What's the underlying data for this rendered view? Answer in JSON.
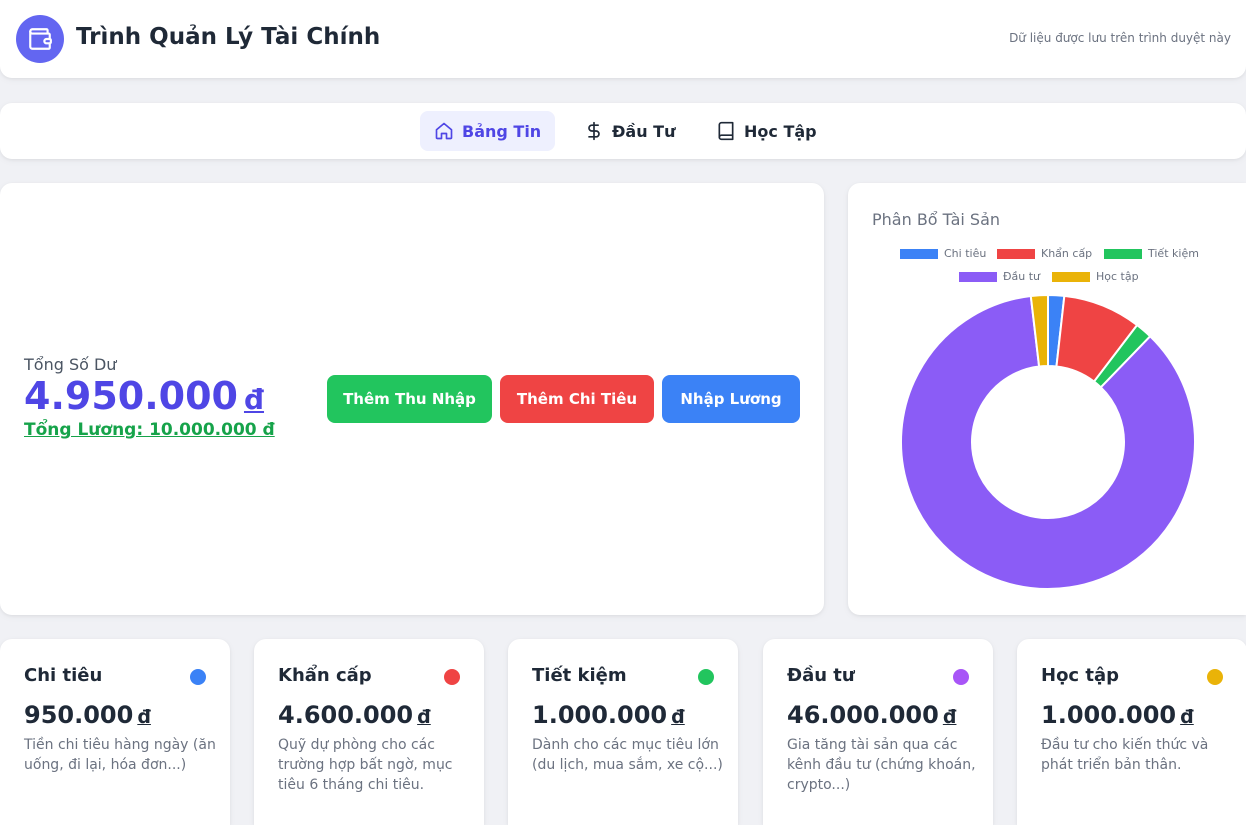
{
  "header": {
    "title": "Trình Quản Lý Tài Chính",
    "storage_note": "Dữ liệu được lưu trên trình duyệt này",
    "logo_icon": "wallet-icon",
    "brand_color": "#6366f1"
  },
  "nav": {
    "tabs": [
      {
        "label": "Bảng Tin",
        "icon": "home-icon",
        "active": true
      },
      {
        "label": "Đầu Tư",
        "icon": "dollar-icon",
        "active": false
      },
      {
        "label": "Học Tập",
        "icon": "book-icon",
        "active": false
      }
    ]
  },
  "balance": {
    "label": "Tổng Số Dư",
    "value": "4.950.000",
    "currency": "đ",
    "salary_total": "Tổng Lương: 10.000.000 đ"
  },
  "actions": {
    "add_income": "Thêm Thu Nhập",
    "add_expense": "Thêm Chi Tiêu",
    "enter_salary": "Nhập Lương"
  },
  "chart_data": {
    "type": "pie",
    "title": "Phân Bổ Tài Sản",
    "donut": true,
    "legend_position": "top",
    "categories": [
      "Chi tiêu",
      "Khẩn cấp",
      "Tiết kiệm",
      "Đầu tư",
      "Học tập"
    ],
    "values": [
      950000,
      4600000,
      1000000,
      46000000,
      1000000
    ],
    "colors": [
      "#3b82f6",
      "#ef4444",
      "#22c55e",
      "#8b5cf6",
      "#eab308"
    ]
  },
  "categories": [
    {
      "name": "Chi tiêu",
      "amount": "950.000",
      "currency": "đ",
      "color": "#3b82f6",
      "desc": "Tiền chi tiêu hàng ngày (ăn uống, đi lại, hóa đơn...)"
    },
    {
      "name": "Khẩn cấp",
      "amount": "4.600.000",
      "currency": "đ",
      "color": "#ef4444",
      "desc": "Quỹ dự phòng cho các trường hợp bất ngờ, mục tiêu 6 tháng chi tiêu."
    },
    {
      "name": "Tiết kiệm",
      "amount": "1.000.000",
      "currency": "đ",
      "color": "#22c55e",
      "desc": "Dành cho các mục tiêu lớn (du lịch, mua sắm, xe cộ...)"
    },
    {
      "name": "Đầu tư",
      "amount": "46.000.000",
      "currency": "đ",
      "color": "#a855f7",
      "desc": "Gia tăng tài sản qua các kênh đầu tư (chứng khoán, crypto...)"
    },
    {
      "name": "Học tập",
      "amount": "1.000.000",
      "currency": "đ",
      "color": "#eab308",
      "desc": "Đầu tư cho kiến thức và phát triển bản thân."
    }
  ]
}
